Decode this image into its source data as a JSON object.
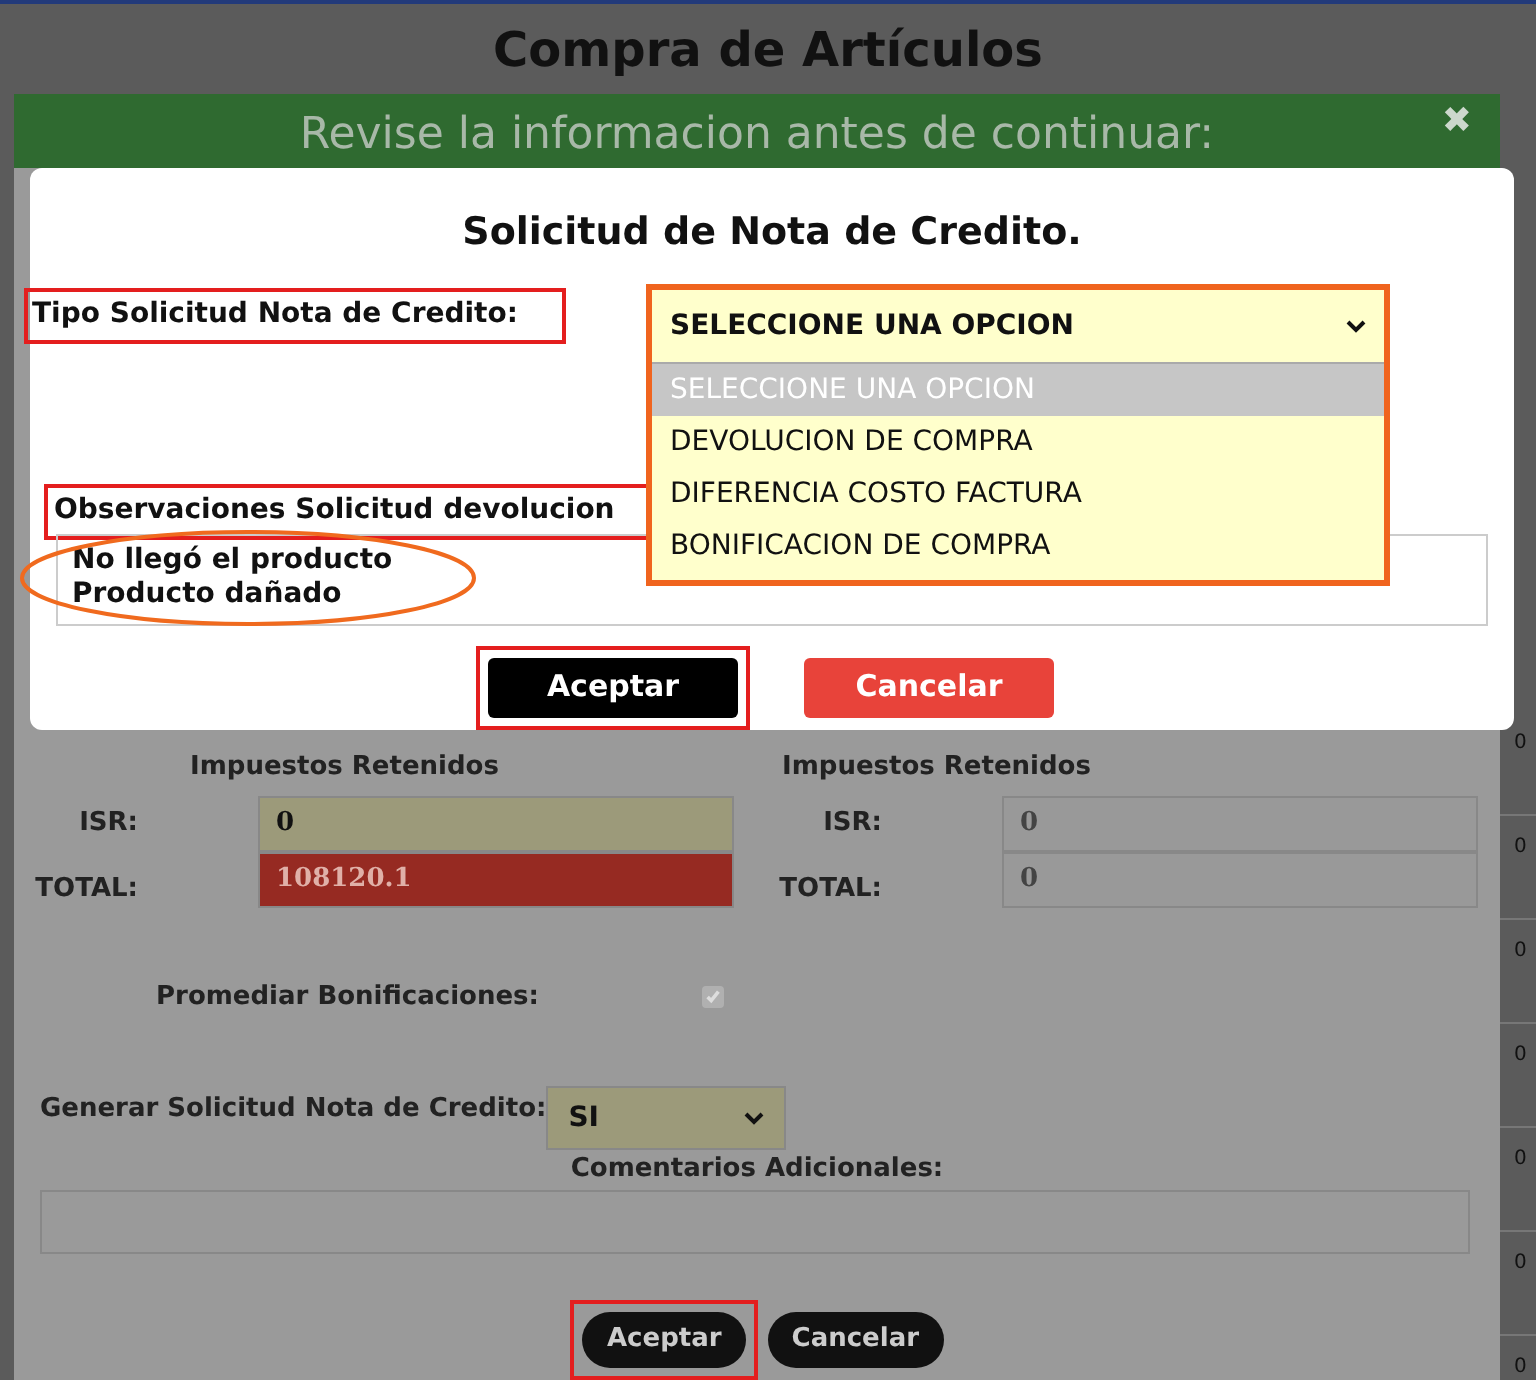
{
  "page": {
    "title": "Compra de Artículos"
  },
  "edge_column": {
    "cells": [
      "0",
      "0",
      "0",
      "0",
      "0",
      "0",
      "0"
    ]
  },
  "review_panel": {
    "header": "Revise la informacion antes de continuar:",
    "close": "✖",
    "left": {
      "heading": "Impuestos Retenidos",
      "isr_label": "ISR:",
      "isr_value": "0",
      "total_label": "TOTAL:",
      "total_value": "108120.1"
    },
    "right": {
      "heading": "Impuestos Retenidos",
      "isr_label": "ISR:",
      "isr_value": "0",
      "total_label": "TOTAL:",
      "total_value": "0"
    },
    "promediar": {
      "label": "Promediar Bonificaciones:",
      "checked": true,
      "disabled": true
    },
    "generar": {
      "label": "Generar Solicitud Nota de Credito:",
      "value": "SI"
    },
    "comentarios": {
      "label": "Comentarios Adicionales:"
    },
    "buttons": [
      {
        "label": "Aceptar",
        "highlighted": true
      },
      {
        "label": "Cancelar",
        "highlighted": false
      }
    ]
  },
  "dialog": {
    "title": "Solicitud de Nota de Credito.",
    "tipo_label": "Tipo Solicitud Nota de Credito:",
    "tipo_select": {
      "value": "SELECCIONE UNA OPCION",
      "expanded": true,
      "options": [
        {
          "label": "SELECCIONE UNA OPCION",
          "selected": true
        },
        {
          "label": "DEVOLUCION DE COMPRA",
          "selected": false
        },
        {
          "label": "DIFERENCIA COSTO FACTURA",
          "selected": false
        },
        {
          "label": "BONIFICACION DE COMPRA",
          "selected": false
        }
      ]
    },
    "observaciones_label": "Observaciones Solicitud devolucion",
    "observaciones_lines": [
      "No llegó el producto",
      "Producto dañado"
    ],
    "buttons": [
      {
        "label": "Aceptar",
        "kind": "primary",
        "highlighted": true
      },
      {
        "label": "Cancelar",
        "kind": "danger",
        "highlighted": false
      }
    ]
  }
}
